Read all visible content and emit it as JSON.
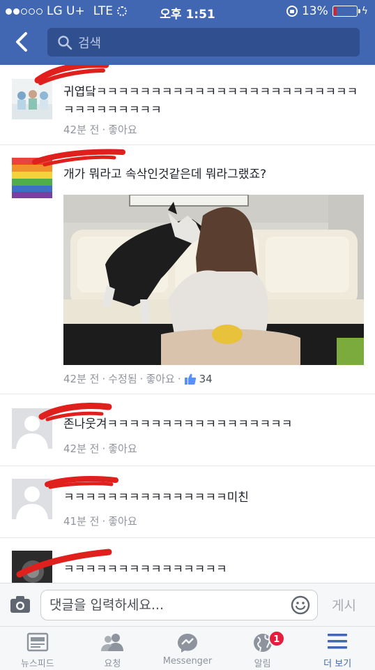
{
  "status_bar": {
    "carrier": "LG U+",
    "network": "LTE",
    "time": "오후 1:51",
    "battery_percent": "13%",
    "battery_level": 0.13
  },
  "nav": {
    "back_icon": "chevron-left-icon",
    "search_placeholder": "검색"
  },
  "colors": {
    "brand": "#4267b2",
    "scribble": "#e0201c",
    "badge": "#e41e3f",
    "meta": "#90949c"
  },
  "comments": [
    {
      "text": "귀엽닼ㅋㅋㅋㅋㅋㅋㅋㅋㅋㅋㅋㅋㅋㅋㅋㅋㅋㅋㅋㅋㅋㅋㅋㅋㅋㅋㅋㅋㅋㅋㅋㅋㅋ",
      "text_line2": "",
      "time": "42분 전",
      "like": "좋아요"
    },
    {
      "text": "개가 뭐라고 속삭인것같은데 뭐라그랬죠?",
      "time": "42분 전",
      "edited": "수정됨",
      "like": "좋아요",
      "like_count": "34"
    },
    {
      "text": "존나웃겨ㅋㅋㅋㅋㅋㅋㅋㅋㅋㅋㅋㅋㅋㅋㅋㅋㅋ",
      "time": "42분 전",
      "like": "좋아요"
    },
    {
      "text": "ㅋㅋㅋㅋㅋㅋㅋㅋㅋㅋㅋㅋㅋㅋㅋ미친",
      "time": "41분 전",
      "like": "좋아요"
    },
    {
      "text": "ㅋㅋㅋㅋㅋㅋㅋㅋㅋㅋㅋㅋㅋㅋㅋ"
    }
  ],
  "composer": {
    "placeholder": "댓글을 입력하세요...",
    "post_label": "게시"
  },
  "tabs": [
    {
      "label": "뉴스피드",
      "icon": "newsfeed-icon"
    },
    {
      "label": "요청",
      "icon": "friend-requests-icon"
    },
    {
      "label": "Messenger",
      "icon": "messenger-icon"
    },
    {
      "label": "알림",
      "icon": "globe-notifications-icon",
      "badge": "1"
    },
    {
      "label": "더 보기",
      "icon": "menu-icon"
    }
  ]
}
